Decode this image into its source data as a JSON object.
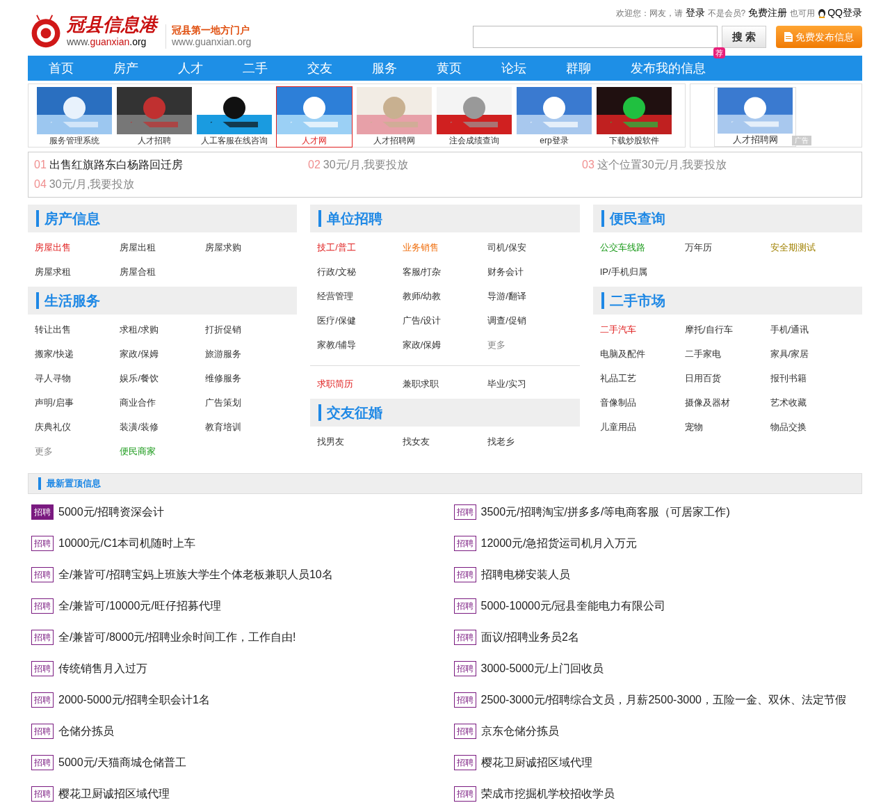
{
  "header": {
    "logo": {
      "name": "冠县信息港",
      "url_prefix": "www.",
      "url_highlight": "guanxian",
      "url_suffix": ".org"
    },
    "slogan": "冠县第一地方门户",
    "slogan_url": "www.guanxian.org",
    "user_bar": [
      {
        "text": "欢迎您：网友，请",
        "kind": "plain"
      },
      {
        "text": "登录",
        "kind": "link"
      },
      {
        "text": "不是会员?",
        "kind": "plain"
      },
      {
        "text": "免费注册",
        "kind": "link"
      },
      {
        "text": "也可用",
        "kind": "plain"
      },
      {
        "text": "QQ登录",
        "kind": "qq"
      }
    ],
    "search_button": "搜 索",
    "post_button": "免费发布信息"
  },
  "nav": [
    {
      "label": "首页"
    },
    {
      "label": "房产"
    },
    {
      "label": "人才"
    },
    {
      "label": "二手"
    },
    {
      "label": "交友"
    },
    {
      "label": "服务"
    },
    {
      "label": "黄页"
    },
    {
      "label": "论坛"
    },
    {
      "label": "群聊"
    },
    {
      "label": "发布我的信息",
      "badge": "荐"
    }
  ],
  "banner_ads": [
    {
      "caption": "服务管理系统",
      "selected": false
    },
    {
      "caption": "人才招聘",
      "selected": false
    },
    {
      "caption": "人工客服在线咨询",
      "selected": false
    },
    {
      "caption": "人才网",
      "selected": true
    },
    {
      "caption": "人才招聘网",
      "selected": false
    },
    {
      "caption": "注会成绩查询",
      "selected": false
    },
    {
      "caption": "erp登录",
      "selected": false
    },
    {
      "caption": "下载炒股软件",
      "selected": false
    }
  ],
  "side_ad": {
    "caption": "人才招聘网",
    "tag": "广告"
  },
  "text_ads": [
    {
      "number": "01",
      "text": "出售红旗路东白杨路回迁房",
      "filled": true
    },
    {
      "number": "02",
      "text": "30元/月,我要投放",
      "filled": false
    },
    {
      "number": "03",
      "text": "这个位置30元/月,我要投放",
      "filled": false
    },
    {
      "number": "04",
      "text": "30元/月,我要投放",
      "filled": false
    }
  ],
  "columns": [
    {
      "sections": [
        {
          "title": "房产信息",
          "groups": [
            [
              {
                "text": "房屋出售",
                "kind": "hot"
              },
              {
                "text": "房屋出租",
                "kind": "normal"
              },
              {
                "text": "房屋求购",
                "kind": "normal"
              },
              {
                "text": "房屋求租",
                "kind": "normal"
              },
              {
                "text": "房屋合租",
                "kind": "normal"
              }
            ]
          ]
        },
        {
          "title": "生活服务",
          "groups": [
            [
              {
                "text": "转让出售",
                "kind": "normal"
              },
              {
                "text": "求租/求购",
                "kind": "normal"
              },
              {
                "text": "打折促销",
                "kind": "normal"
              },
              {
                "text": "搬家/快递",
                "kind": "normal"
              },
              {
                "text": "家政/保姆",
                "kind": "normal"
              },
              {
                "text": "旅游服务",
                "kind": "normal"
              },
              {
                "text": "寻人寻物",
                "kind": "normal"
              },
              {
                "text": "娱乐/餐饮",
                "kind": "normal"
              },
              {
                "text": "维修服务",
                "kind": "normal"
              },
              {
                "text": "声明/启事",
                "kind": "normal"
              },
              {
                "text": "商业合作",
                "kind": "normal"
              },
              {
                "text": "广告策划",
                "kind": "normal"
              },
              {
                "text": "庆典礼仪",
                "kind": "normal"
              },
              {
                "text": "装潢/装修",
                "kind": "normal"
              },
              {
                "text": "教育培训",
                "kind": "normal"
              },
              {
                "text": "更多",
                "kind": "more"
              },
              {
                "text": "便民商家",
                "kind": "service"
              }
            ]
          ]
        }
      ]
    },
    {
      "sections": [
        {
          "title": "单位招聘",
          "groups": [
            [
              {
                "text": "技工/普工",
                "kind": "hot"
              },
              {
                "text": "业务销售",
                "kind": "sale"
              },
              {
                "text": "司机/保安",
                "kind": "normal"
              },
              {
                "text": "行政/文秘",
                "kind": "normal"
              },
              {
                "text": "客服/打杂",
                "kind": "normal"
              },
              {
                "text": "财务会计",
                "kind": "normal"
              },
              {
                "text": "经营管理",
                "kind": "normal"
              },
              {
                "text": "教师/幼教",
                "kind": "normal"
              },
              {
                "text": "导游/翻译",
                "kind": "normal"
              },
              {
                "text": "医疗/保健",
                "kind": "normal"
              },
              {
                "text": "广告/设计",
                "kind": "normal"
              },
              {
                "text": "调查/促销",
                "kind": "normal"
              },
              {
                "text": "家教/辅导",
                "kind": "normal"
              },
              {
                "text": "家政/保姆",
                "kind": "normal"
              },
              {
                "text": "更多",
                "kind": "more"
              }
            ],
            [
              {
                "text": "求职简历",
                "kind": "hot"
              },
              {
                "text": "兼职求职",
                "kind": "normal"
              },
              {
                "text": "毕业/实习",
                "kind": "normal"
              }
            ]
          ]
        },
        {
          "title": "交友征婚",
          "groups": [
            [
              {
                "text": "找男友",
                "kind": "normal"
              },
              {
                "text": "找女友",
                "kind": "normal"
              },
              {
                "text": "找老乡",
                "kind": "normal"
              }
            ]
          ]
        }
      ]
    },
    {
      "sections": [
        {
          "title": "便民查询",
          "groups": [
            [
              {
                "text": "公交车线路",
                "kind": "service"
              },
              {
                "text": "万年历",
                "kind": "normal"
              },
              {
                "text": "安全期测试",
                "kind": "tool"
              },
              {
                "text": "IP/手机归属",
                "kind": "normal"
              }
            ]
          ]
        },
        {
          "title": "二手市场",
          "groups": [
            [
              {
                "text": "二手汽车",
                "kind": "hot"
              },
              {
                "text": "摩托/自行车",
                "kind": "normal"
              },
              {
                "text": "手机/通讯",
                "kind": "normal"
              },
              {
                "text": "电脑及配件",
                "kind": "normal"
              },
              {
                "text": "二手家电",
                "kind": "normal"
              },
              {
                "text": "家具/家居",
                "kind": "normal"
              },
              {
                "text": "礼品工艺",
                "kind": "normal"
              },
              {
                "text": "日用百货",
                "kind": "normal"
              },
              {
                "text": "报刊书籍",
                "kind": "normal"
              },
              {
                "text": "音像制品",
                "kind": "normal"
              },
              {
                "text": "摄像及器材",
                "kind": "normal"
              },
              {
                "text": "艺术收藏",
                "kind": "normal"
              },
              {
                "text": "儿童用品",
                "kind": "normal"
              },
              {
                "text": "宠物",
                "kind": "normal"
              },
              {
                "text": "物品交换",
                "kind": "normal"
              }
            ]
          ]
        }
      ]
    }
  ],
  "top_listings": {
    "title": "最新置顶信息",
    "items": [
      {
        "badge": "招聘",
        "text": "5000元/招聘资深会计",
        "highlighted": true
      },
      {
        "badge": "招聘",
        "text": "3500元/招聘淘宝/拼多多/等电商客服（可居家工作)",
        "highlighted": false
      },
      {
        "badge": "招聘",
        "text": "10000元/C1本司机随时上车",
        "highlighted": false
      },
      {
        "badge": "招聘",
        "text": "12000元/急招货运司机月入万元",
        "highlighted": false
      },
      {
        "badge": "招聘",
        "text": "全/兼皆可/招聘宝妈上班族大学生个体老板兼职人员10名",
        "highlighted": false
      },
      {
        "badge": "招聘",
        "text": "招聘电梯安装人员",
        "highlighted": false
      },
      {
        "badge": "招聘",
        "text": "全/兼皆可/10000元/旺仔招募代理",
        "highlighted": false
      },
      {
        "badge": "招聘",
        "text": "5000-10000元/冠县奎能电力有限公司",
        "highlighted": false
      },
      {
        "badge": "招聘",
        "text": "全/兼皆可/8000元/招聘业余时间工作，工作自由!",
        "highlighted": false
      },
      {
        "badge": "招聘",
        "text": "面议/招聘业务员2名",
        "highlighted": false
      },
      {
        "badge": "招聘",
        "text": "传统销售月入过万",
        "highlighted": false
      },
      {
        "badge": "招聘",
        "text": "3000-5000元/上门回收员",
        "highlighted": false
      },
      {
        "badge": "招聘",
        "text": "2000-5000元/招聘全职会计1名",
        "highlighted": false
      },
      {
        "badge": "招聘",
        "text": "2500-3000元/招聘综合文员，月薪2500-3000，五险一金、双休、法定节假",
        "highlighted": false
      },
      {
        "badge": "招聘",
        "text": "仓储分拣员",
        "highlighted": false
      },
      {
        "badge": "招聘",
        "text": "京东仓储分拣员",
        "highlighted": false
      },
      {
        "badge": "招聘",
        "text": "5000元/天猫商城仓储普工",
        "highlighted": false
      },
      {
        "badge": "招聘",
        "text": "樱花卫厨诚招区域代理",
        "highlighted": false
      },
      {
        "badge": "招聘",
        "text": "樱花卫厨诚招区域代理",
        "highlighted": false
      },
      {
        "badge": "招聘",
        "text": "荣成市挖掘机学校招收学员",
        "highlighted": false
      }
    ]
  }
}
